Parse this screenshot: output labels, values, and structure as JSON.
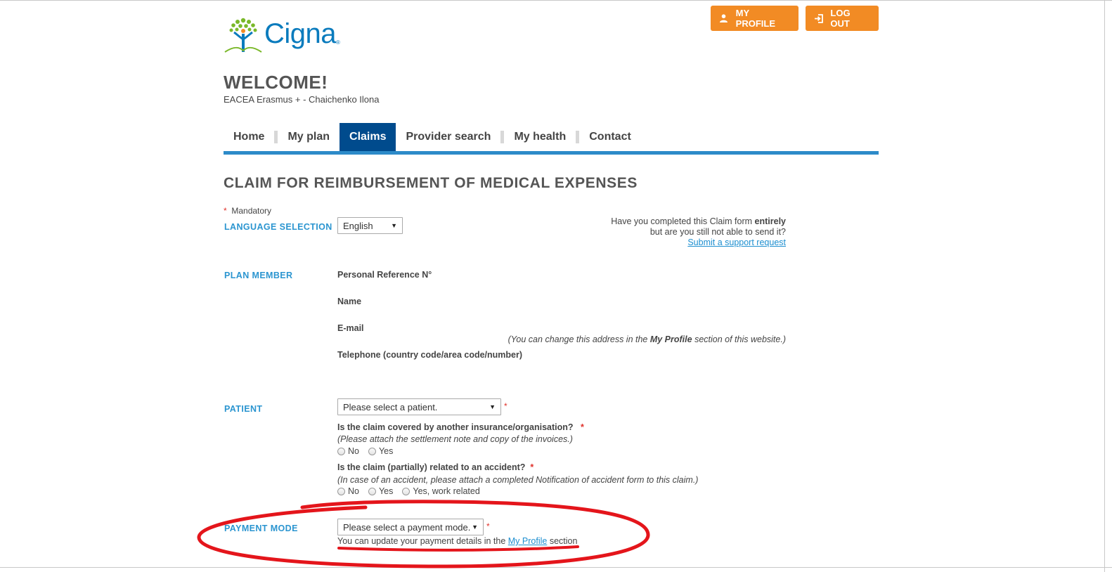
{
  "header": {
    "logo_text": "Cigna",
    "logo_reg": "®",
    "my_profile_label": "MY PROFILE",
    "logout_label": "LOG OUT",
    "welcome_title": "WELCOME!",
    "welcome_subtitle": "EACEA Erasmus + - Chaichenko Ilona"
  },
  "nav": {
    "items": [
      {
        "label": "Home"
      },
      {
        "label": "My plan"
      },
      {
        "label": "Claims"
      },
      {
        "label": "Provider search"
      },
      {
        "label": "My health"
      },
      {
        "label": "Contact"
      }
    ],
    "active_index": 2
  },
  "form": {
    "title": "CLAIM FOR REIMBURSEMENT OF MEDICAL EXPENSES",
    "mandatory_star": "*",
    "mandatory_label": "Mandatory",
    "language": {
      "label": "LANGUAGE SELECTION",
      "value": "English"
    },
    "help": {
      "line1_prefix": "Have you completed this Claim form ",
      "line1_bold": "entirely",
      "line2": "but are you still not able to send it?",
      "link": "Submit a support request"
    },
    "plan_member": {
      "label": "PLAN MEMBER",
      "ref_label": "Personal Reference N°",
      "name_label": "Name",
      "email_label": "E-mail",
      "email_note_prefix": "(You can change this address in the ",
      "email_note_bold": "My Profile",
      "email_note_suffix": " section of this website.)",
      "phone_label": "Telephone (country code/area code/number)"
    },
    "patient": {
      "label": "PATIENT",
      "select_value": "Please select a patient.",
      "q1": "Is the claim covered by another insurance/organisation?",
      "q1_note": "(Please attach the settlement note and copy of the invoices.)",
      "q1_options": [
        "No",
        "Yes"
      ],
      "q2": "Is the claim (partially) related to an accident?",
      "q2_note": "(In case of an accident, please attach a completed Notification of accident form to this claim.)",
      "q2_options": [
        "No",
        "Yes",
        "Yes, work related"
      ]
    },
    "payment": {
      "label": "PAYMENT MODE",
      "select_value": "Please select a payment mode.",
      "note_prefix": "You can update your payment details in the ",
      "note_link": "My Profile",
      "note_suffix": " section"
    }
  },
  "colors": {
    "brand_blue": "#0a7bbd",
    "accent_orange": "#f28b24",
    "nav_active": "#004b8d",
    "section_label": "#2b95d0",
    "annotation_red": "#e4151b"
  }
}
